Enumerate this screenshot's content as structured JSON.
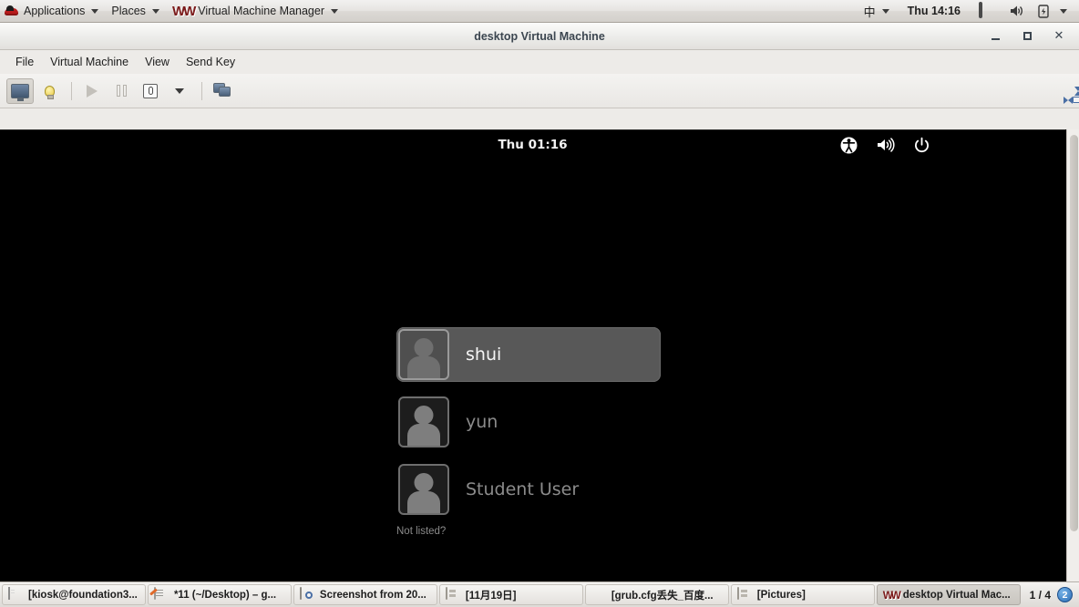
{
  "gnome_panel": {
    "applications_label": "Applications",
    "places_label": "Places",
    "vmm_label": "Virtual Machine Manager",
    "input_method": "中",
    "clock": "Thu 14:16"
  },
  "vmm_window": {
    "title": "desktop Virtual Machine",
    "menus": [
      "File",
      "Virtual Machine",
      "View",
      "Send Key"
    ],
    "toolbar": {
      "console_tooltip": "Show the graphical console",
      "details_tooltip": "Show virtual hardware details",
      "run_label": "Run",
      "pause_label": "Pause",
      "shutdown_label": "Shut Down",
      "snapshot_label": "Manage VM snapshots",
      "fullscreen_label": "Fullscreen"
    },
    "window_buttons": {
      "minimize": "–",
      "maximize": "□",
      "close": "✕"
    }
  },
  "vm_screen": {
    "gdm": {
      "clock": "Thu 01:16",
      "tray": [
        "accessibility-icon",
        "volume-icon",
        "power-icon"
      ],
      "users": [
        {
          "name": "shui",
          "selected": true
        },
        {
          "name": "yun",
          "selected": false
        },
        {
          "name": "Student User",
          "selected": false
        }
      ],
      "not_listed_label": "Not listed?"
    }
  },
  "taskbar": {
    "tasks": [
      {
        "label": "[kiosk@foundation3...",
        "icon": "terminal-icon",
        "active": false
      },
      {
        "label": "*11 (~/Desktop) – g...",
        "icon": "gedit-icon",
        "active": false
      },
      {
        "label": "Screenshot from 20...",
        "icon": "screenshot-icon",
        "active": false
      },
      {
        "label": "[11月19日]",
        "icon": "file-manager-icon",
        "active": false
      },
      {
        "label": "[grub.cfg丢失_百度...",
        "icon": "firefox-icon",
        "active": false
      },
      {
        "label": "[Pictures]",
        "icon": "file-manager-icon",
        "active": false
      },
      {
        "label": "desktop Virtual Mac...",
        "icon": "vmm-icon",
        "active": true
      }
    ],
    "workspace_indicator": "1 / 4",
    "workspace_badge": "2"
  },
  "colors": {
    "panel_bg": "#e6e4e1",
    "vm_bg": "#000000",
    "selected_user_bg": "#585858",
    "accent_blue": "#2a6db5",
    "redhat_red": "#b81b1b"
  }
}
